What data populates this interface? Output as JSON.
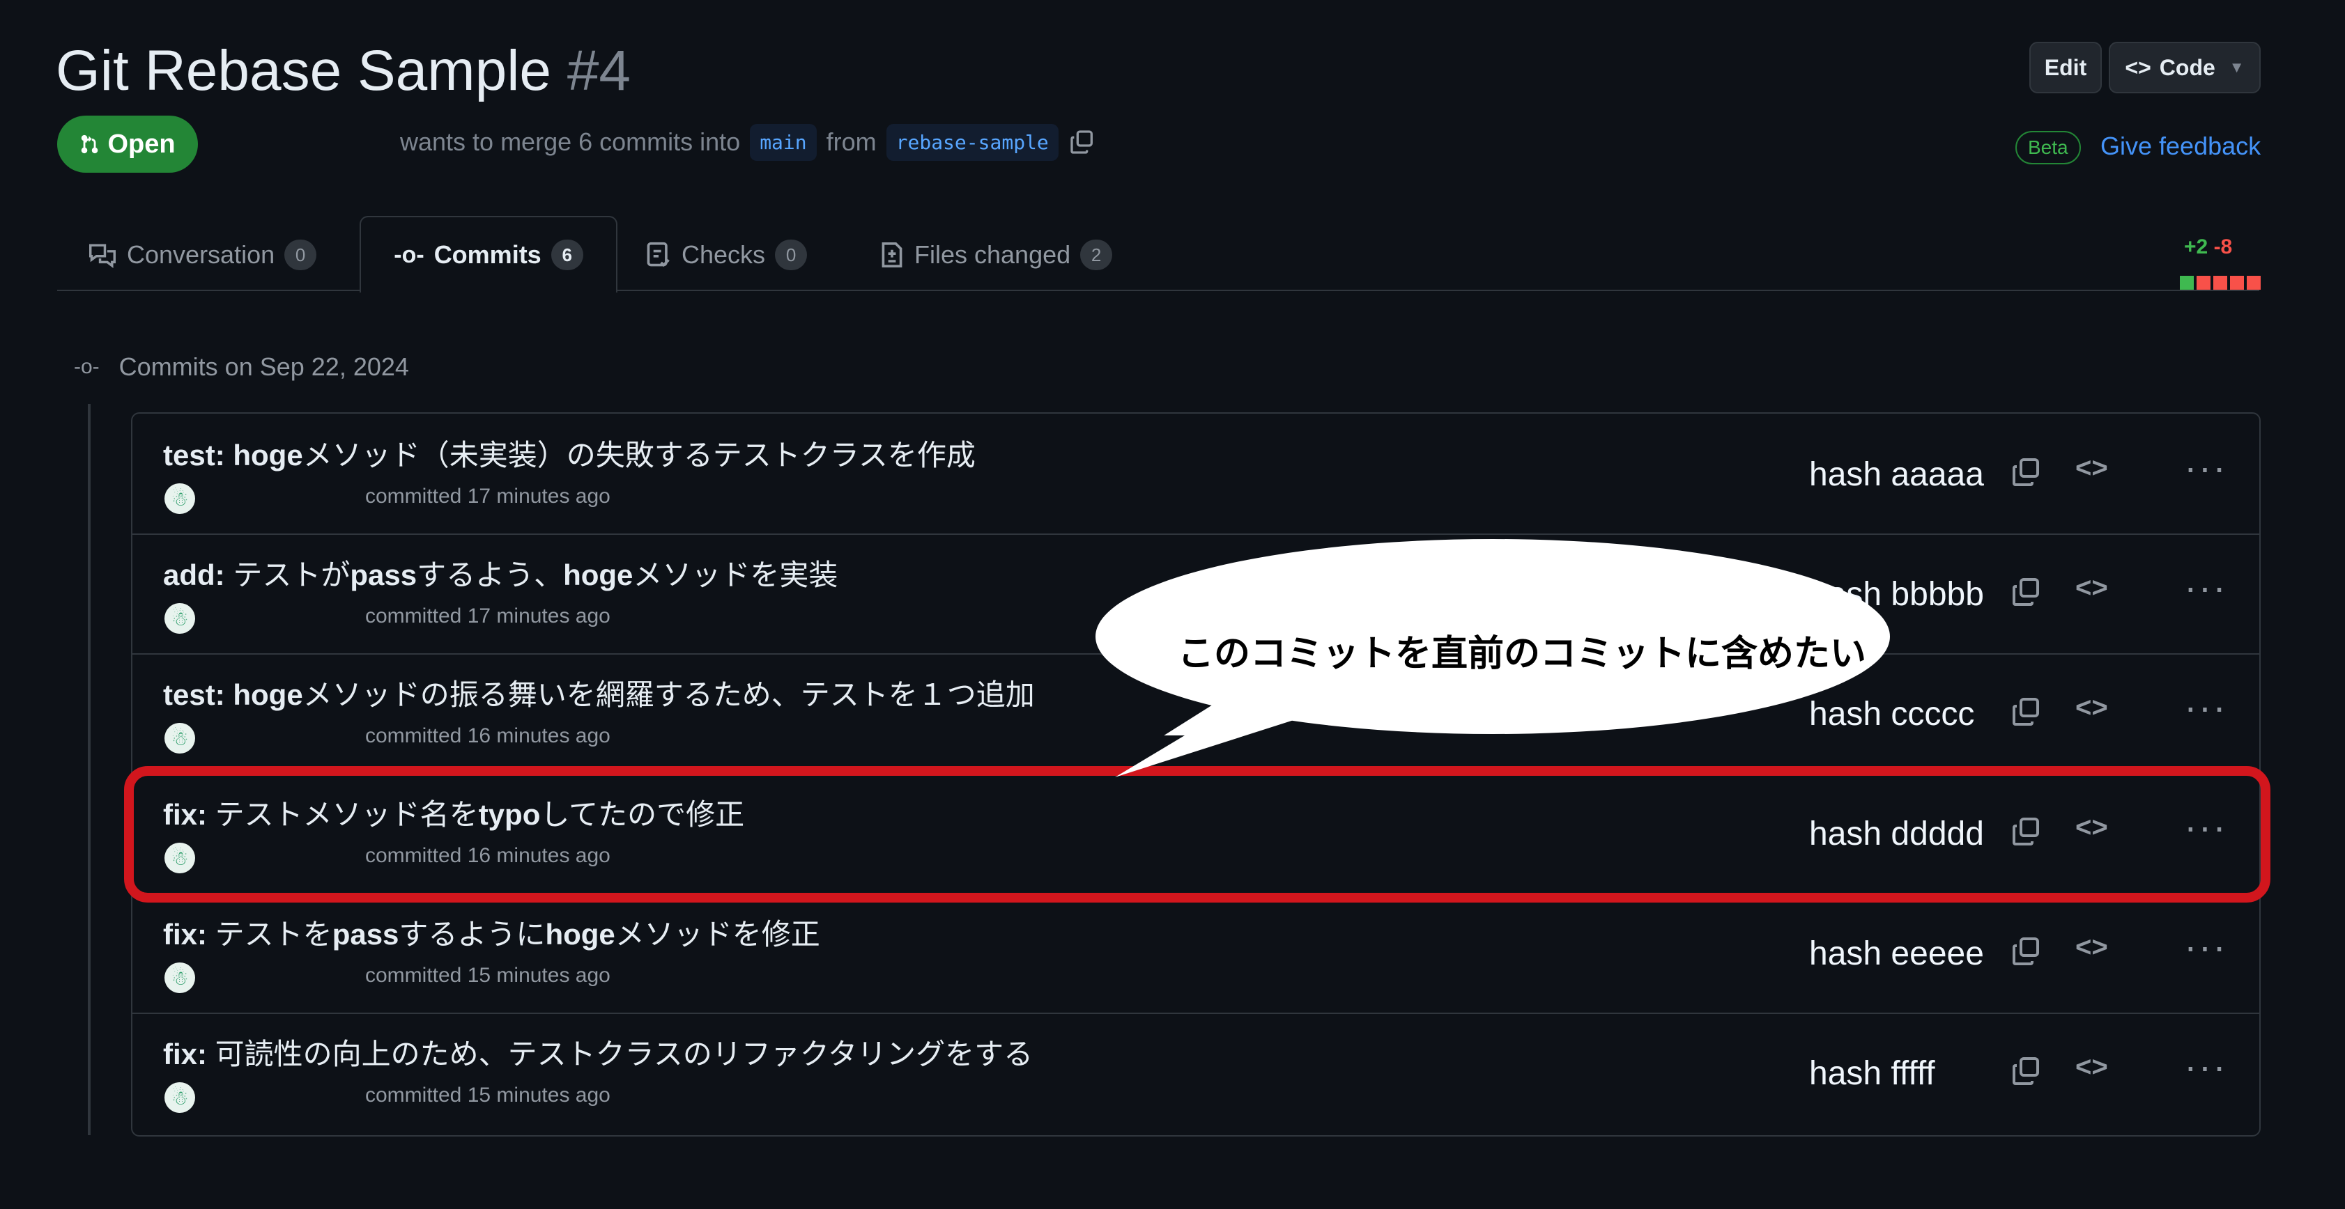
{
  "header": {
    "title": "Git Rebase Sample",
    "number": "#4",
    "edit_label": "Edit",
    "code_label": "Code",
    "status": "Open",
    "merge_prefix": "wants to merge 6 commits into",
    "base_branch": "main",
    "from_word": "from",
    "head_branch": "rebase-sample",
    "beta": "Beta",
    "feedback": "Give feedback"
  },
  "tabs": [
    {
      "label": "Conversation",
      "count": "0"
    },
    {
      "label": "Commits",
      "count": "6"
    },
    {
      "label": "Checks",
      "count": "0"
    },
    {
      "label": "Files changed",
      "count": "2"
    }
  ],
  "diff": {
    "additions": "+2",
    "deletions": "-8"
  },
  "commits_date": "Commits on Sep 22, 2024",
  "commits": [
    {
      "type": "test:",
      "prefix": "",
      "bold1": "hoge",
      "rest": "メソッド（未実装）の失敗するテストクラスを作成",
      "time": "committed 17 minutes ago",
      "hash": "hash aaaaa"
    },
    {
      "type": "add:",
      "prefix": "テストが",
      "bold1": "pass",
      "rest": "するよう、",
      "bold2": "hoge",
      "rest2": "メソッドを実装",
      "time": "committed 17 minutes ago",
      "hash": "hash bbbbb"
    },
    {
      "type": "test:",
      "prefix": "",
      "bold1": "hoge",
      "rest": "メソッドの振る舞いを網羅するため、テストを１つ追加",
      "time": "committed 16 minutes ago",
      "hash": "hash ccccc"
    },
    {
      "type": "fix:",
      "prefix": "テストメソッド名を",
      "bold1": "typo",
      "rest": "してたので修正",
      "time": "committed 16 minutes ago",
      "hash": "hash ddddd"
    },
    {
      "type": "fix:",
      "prefix": "テストを",
      "bold1": "pass",
      "rest": "するように",
      "bold2": "hoge",
      "rest2": "メソッドを修正",
      "time": "committed 15 minutes ago",
      "hash": "hash eeeee"
    },
    {
      "type": "fix:",
      "prefix": "可読性の向上のため、テストクラスのリファクタリングをする",
      "bold1": "",
      "rest": "",
      "time": "committed 15 minutes ago",
      "hash": "hash fffff"
    }
  ],
  "annotation": {
    "bubble_text": "このコミットを直前のコミットに含めたい",
    "highlight_color": "#d2161d"
  },
  "colors": {
    "background": "#0d1117",
    "open_green": "#238636",
    "link_blue": "#4493f8"
  }
}
